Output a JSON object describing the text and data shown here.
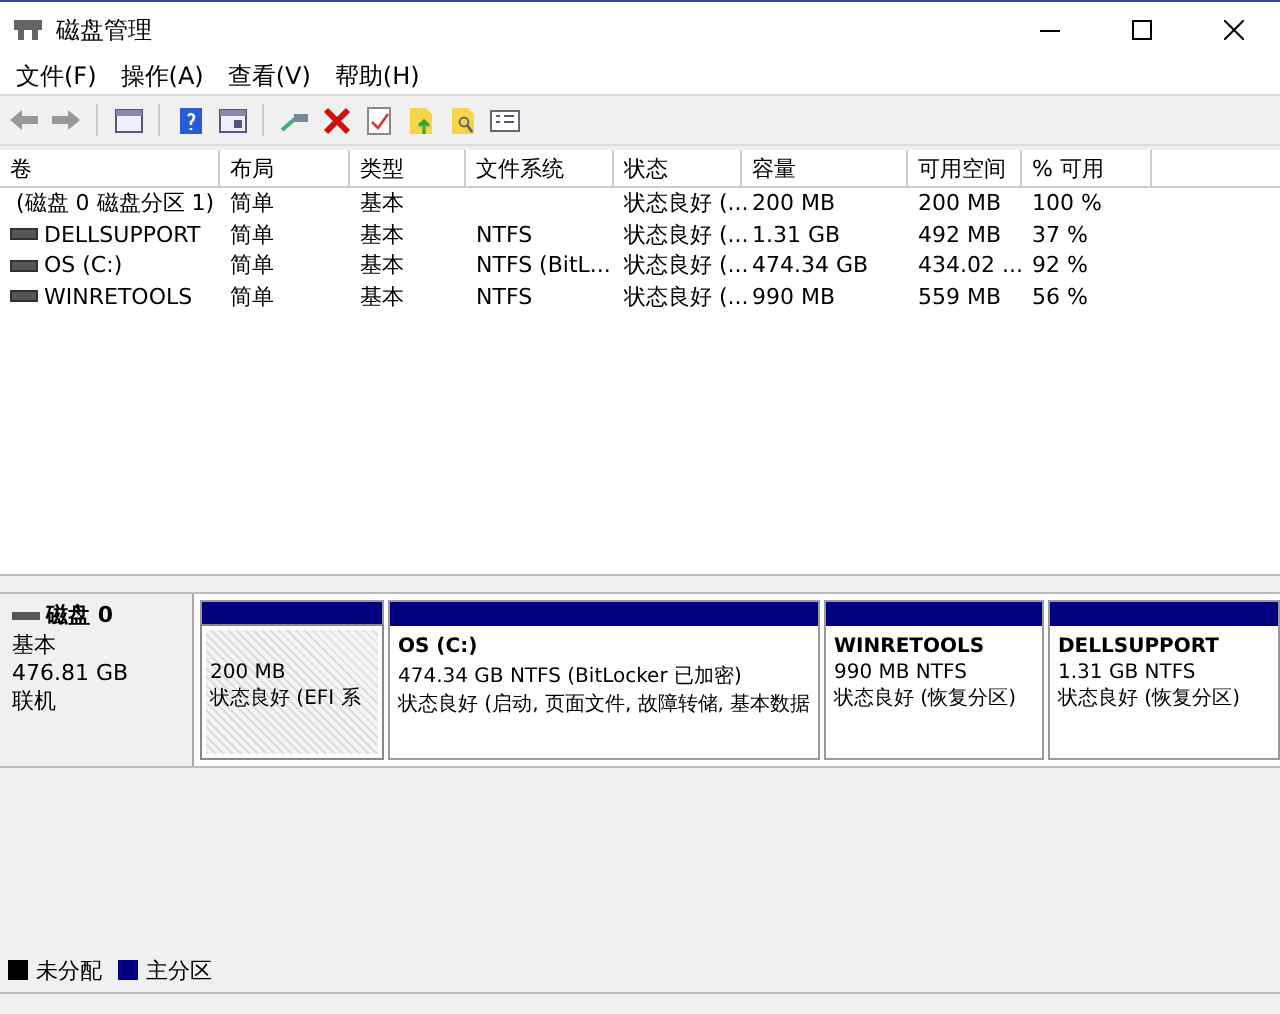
{
  "window": {
    "title": "磁盘管理"
  },
  "menu": [
    "文件(F)",
    "操作(A)",
    "查看(V)",
    "帮助(H)"
  ],
  "table": {
    "columns": [
      "卷",
      "布局",
      "类型",
      "文件系统",
      "状态",
      "容量",
      "可用空间",
      "% 可用"
    ],
    "rows": [
      {
        "kind": "system",
        "cells": [
          "(磁盘 0 磁盘分区 1)",
          "简单",
          "基本",
          "",
          "状态良好 (...",
          "200 MB",
          "200 MB",
          "100 %"
        ]
      },
      {
        "kind": "drive",
        "cells": [
          "DELLSUPPORT",
          "简单",
          "基本",
          "NTFS",
          "状态良好 (...",
          "1.31 GB",
          "492 MB",
          "37 %"
        ]
      },
      {
        "kind": "drive",
        "cells": [
          "OS (C:)",
          "简单",
          "基本",
          "NTFS (BitL...",
          "状态良好 (...",
          "474.34 GB",
          "434.02 ...",
          "92 %"
        ]
      },
      {
        "kind": "drive",
        "cells": [
          "WINRETOOLS",
          "简单",
          "基本",
          "NTFS",
          "状态良好 (...",
          "990 MB",
          "559 MB",
          "56 %"
        ]
      }
    ]
  },
  "disk": {
    "name": "磁盘 0",
    "type": "基本",
    "size": "476.81 GB",
    "status": "联机",
    "partitions": [
      {
        "size": "200 MB",
        "status": "状态良好 (EFI 系",
        "selected": true
      },
      {
        "name": "OS  (C:)",
        "size": "474.34 GB NTFS (BitLocker 已加密)",
        "status": "状态良好 (启动, 页面文件, 故障转储, 基本数据",
        "selected": false
      },
      {
        "name": "WINRETOOLS",
        "size": "990 MB NTFS",
        "status": "状态良好 (恢复分区)",
        "selected": false
      },
      {
        "name": "DELLSUPPORT",
        "size": "1.31 GB NTFS",
        "status": "状态良好 (恢复分区)",
        "selected": false
      }
    ]
  },
  "legend": [
    {
      "label": "未分配",
      "color": "#000000"
    },
    {
      "label": "主分区",
      "color": "#000080"
    }
  ]
}
